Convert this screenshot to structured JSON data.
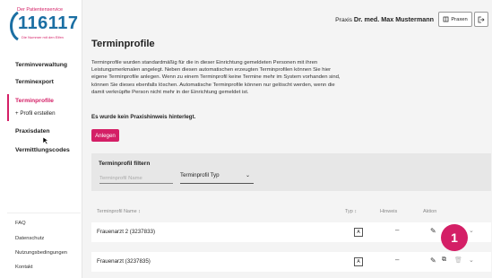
{
  "logo": {
    "top_text": "Der Patientenservice",
    "number": "116117",
    "sub_text": "Die Nummer mit den Elfen"
  },
  "sidebar": {
    "items": [
      {
        "label": "Terminverwaltung"
      },
      {
        "label": "Terminexport"
      },
      {
        "label": "Terminprofile"
      },
      {
        "label": "+ Profil erstellen"
      },
      {
        "label": "Praxisdaten"
      },
      {
        "label": "Vermittlungscodes"
      }
    ],
    "footer": [
      {
        "label": "FAQ"
      },
      {
        "label": "Datenschutz"
      },
      {
        "label": "Nutzungsbedingungen"
      },
      {
        "label": "Kontakt"
      }
    ]
  },
  "header": {
    "practice_prefix": "Praxis",
    "practice_name": "Dr. med. Max Mustermann",
    "praxen_label": "Praxen"
  },
  "main": {
    "title": "Terminprofile",
    "intro": "Terminprofile wurden standardmäßig für die in dieser Einrichtung gemeldeten Personen mit ihren Leistungsmerkmalen angelegt. Neben diesen automatischen erzeugten Terminprofilen können Sie hier eigene Terminprofile anlegen. Wenn zu einem Terminprofil keine Termine mehr im System vorhanden sind, können Sie dieses ebenfalls löschen. Automatische Terminprofile können nur gelöscht werden, wenn die damit verknüpfte Person nicht mehr in der Einrichtung gemeldet ist.",
    "notice": "Es wurde kein Praxishinweis hinterlegt.",
    "create_label": "Anlegen"
  },
  "filter": {
    "title": "Terminprofil filtern",
    "name_placeholder": "Terminprofil Name",
    "type_label": "Terminprofil Typ"
  },
  "table": {
    "headers": {
      "name": "Terminprofil Name ↕",
      "type": "Typ ↕",
      "hint": "Hinweis",
      "action": "Aktion"
    },
    "rows": [
      {
        "name": "Frauenarzt 2 (3237833)",
        "type": "A",
        "hint": "–"
      },
      {
        "name": "Frauenarzt (3237835)",
        "type": "A",
        "hint": "–"
      }
    ]
  },
  "annotation": {
    "badge": "1"
  },
  "colors": {
    "accent": "#d41f66",
    "brand_blue": "#1b6fa3"
  }
}
